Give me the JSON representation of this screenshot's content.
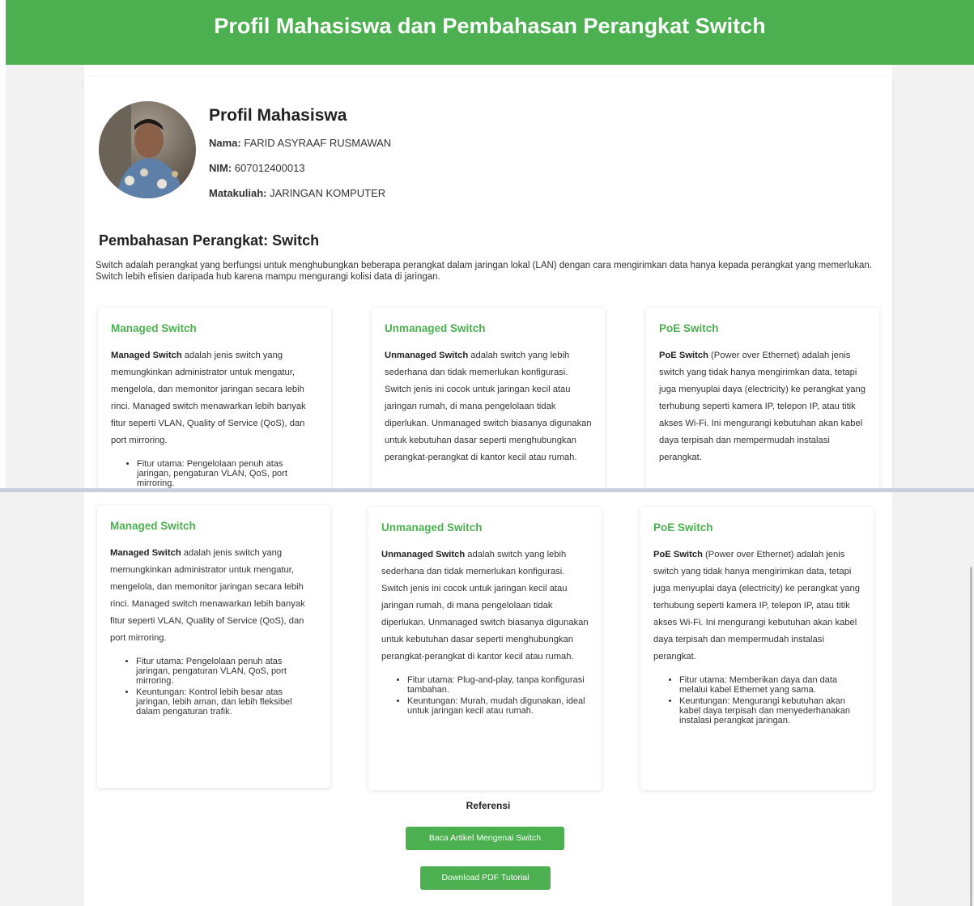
{
  "header": {
    "title": "Profil Mahasiswa dan Pembahasan Perangkat Switch"
  },
  "profile": {
    "heading": "Profil Mahasiswa",
    "nama_label": "Nama:",
    "nama_value": "FARID ASYRAAF RUSMAWAN",
    "nim_label": "NIM:",
    "nim_value": "607012400013",
    "mk_label": "Matakuliah:",
    "mk_value": "JARINGAN KOMPUTER"
  },
  "switch": {
    "title": "Pembahasan Perangkat: Switch",
    "desc": "Switch adalah perangkat yang berfungsi untuk menghubungkan beberapa perangkat dalam jaringan lokal (LAN) dengan cara mengirimkan data hanya kepada perangkat yang memerlukan. Switch lebih efisien daripada hub karena mampu mengurangi kolisi data di jaringan."
  },
  "cards": [
    {
      "title": "Managed Switch",
      "bold": "Managed Switch",
      "text": " adalah jenis switch yang memungkinkan administrator untuk mengatur, mengelola, dan memonitor jaringan secara lebih rinci. Managed switch menawarkan lebih banyak fitur seperti VLAN, Quality of Service (QoS), dan port mirroring.",
      "items": [
        "Fitur utama: Pengelolaan penuh atas jaringan, pengaturan VLAN, QoS, port mirroring.",
        "Keuntungan: Kontrol lebih besar atas jaringan, lebih aman, dan lebih fleksibel dalam pengaturan trafik."
      ]
    },
    {
      "title": "Unmanaged Switch",
      "bold": "Unmanaged Switch",
      "text": " adalah switch yang lebih sederhana dan tidak memerlukan konfigurasi. Switch jenis ini cocok untuk jaringan kecil atau jaringan rumah, di mana pengelolaan tidak diperlukan. Unmanaged switch biasanya digunakan untuk kebutuhan dasar seperti menghubungkan perangkat-perangkat di kantor kecil atau rumah.",
      "items": [
        "Fitur utama: Plug-and-play, tanpa konfigurasi tambahan.",
        "Keuntungan: Murah, mudah digunakan, ideal untuk jaringan kecil atau rumah."
      ]
    },
    {
      "title": "PoE Switch",
      "bold": "PoE Switch",
      "text": " (Power over Ethernet) adalah jenis switch yang tidak hanya mengirimkan data, tetapi juga menyuplai daya (electricity) ke perangkat yang terhubung seperti kamera IP, telepon IP, atau titik akses Wi-Fi. Ini mengurangi kebutuhan akan kabel daya terpisah dan mempermudah instalasi perangkat.",
      "items": [
        "Fitur utama: Memberikan daya dan data melalui kabel Ethernet yang sama.",
        "Keuntungan: Mengurangi kebutuhan akan kabel daya terpisah dan menyederhanakan instalasi perangkat jaringan."
      ]
    }
  ],
  "referensi": {
    "title": "Referensi",
    "btn_article": "Baca Artikel Mengenai Switch",
    "btn_pdf": "Download PDF Tutorial"
  },
  "colors": {
    "accent": "#4caf50",
    "page_bg": "#f2f2f2"
  }
}
